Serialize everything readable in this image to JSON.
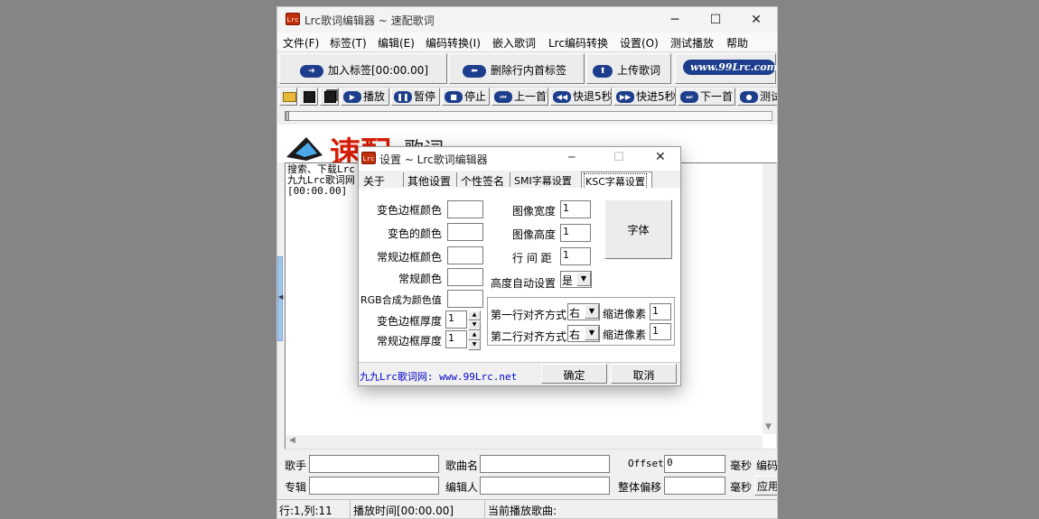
{
  "main_window": {
    "app_icon_text": "Lrc",
    "title": "Lrc歌词编辑器 ~ 速配歌词",
    "controls": {
      "minimize": "─",
      "maximize": "☐",
      "close": "✕"
    }
  },
  "menu": [
    "文件(F)",
    "标签(T)",
    "编辑(E)",
    "编码转换(I)",
    "嵌入歌词",
    "Lrc编码转换",
    "设置(O)",
    "测试播放",
    "帮助"
  ],
  "toolbar": {
    "add_tag": "加入标签[00:00.00]",
    "delete_tag": "删除行内首标签",
    "upload": "上传歌词",
    "website": "www.99Lrc.com"
  },
  "playback": {
    "play": "播放",
    "pause": "暂停",
    "stop": "停止",
    "prev": "上一首",
    "rewind": "快退5秒",
    "forward": "快进5秒",
    "next": "下一首",
    "test": "测试"
  },
  "logo": {
    "big_text": "速配",
    "small_text": "歌词"
  },
  "editor": {
    "lines": [
      "搜索、下载Lrc",
      "九九Lrc歌词网",
      "[00:00.00]"
    ]
  },
  "bottom": {
    "singer_label": "歌手",
    "song_label": "歌曲名",
    "offset_label": "Offset",
    "offset_value": "0",
    "ms_label1": "毫秒",
    "encode_label": "编码",
    "album_label": "专辑",
    "editor_label": "编辑人",
    "overall_offset_label": "整体偏移",
    "ms_label2": "毫秒",
    "apply_label": "应用"
  },
  "status": {
    "position": "行:1,列:11",
    "play_time": "播放时间[00:00.00]",
    "current_song": "当前播放歌曲:"
  },
  "dialog": {
    "title": "设置 ~ Lrc歌词编辑器",
    "tabs": [
      "关于",
      "其他设置",
      "个性签名",
      "SMI字幕设置",
      "KSC字幕设置"
    ],
    "active_tab": "KSC字幕设置",
    "labels": {
      "change_border_color": "变色边框颜色",
      "change_color": "变色的颜色",
      "normal_border_color": "常规边框颜色",
      "normal_color": "常规颜色",
      "rgb_color": "RGB合成为颜色值",
      "change_border_thickness": "变色边框厚度",
      "normal_border_thickness": "常规边框厚度",
      "image_width": "图像宽度",
      "image_height": "图像高度",
      "line_spacing": "行 间 距",
      "auto_height": "高度自动设置",
      "line1_align": "第一行对齐方式",
      "line2_align": "第二行对齐方式",
      "indent1": "缩进像素",
      "indent2": "缩进像素"
    },
    "values": {
      "change_border_thickness": "1",
      "normal_border_thickness": "1",
      "image_width": "1",
      "image_height": "1",
      "line_spacing": "1",
      "auto_height": "是",
      "line1_align": "右",
      "line2_align": "右",
      "indent1": "1",
      "indent2": "1"
    },
    "font_button": "字体",
    "link": "九九Lrc歌词网: www.99Lrc.net",
    "ok": "确定",
    "cancel": "取消",
    "controls": {
      "minimize": "─",
      "maximize": "☐",
      "close": "✕"
    }
  },
  "colors": {
    "desktop": "#858585",
    "icon_blue": "#1d3e8c",
    "link_blue": "#0000cc",
    "logo_red": "#d81e06"
  }
}
